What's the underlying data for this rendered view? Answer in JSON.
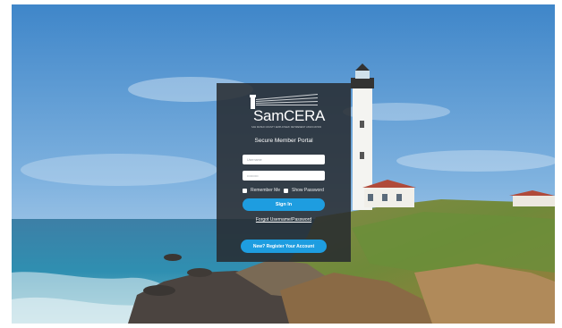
{
  "logo": {
    "name": "SamCERA",
    "subtitle": "SAN MATEO COUNTY EMPLOYEES' RETIREMENT ASSOCIATION"
  },
  "portal": {
    "title": "Secure Member Portal"
  },
  "form": {
    "username_placeholder": "Username",
    "password_placeholder": "Password",
    "password_value": "••••••••••",
    "remember_label": "Remember Me",
    "show_password_label": "Show Password",
    "signin_label": "Sign In",
    "forgot_label": "Forgot Username/Password",
    "register_label": "New? Register Your Account"
  },
  "colors": {
    "accent": "#1e9de0",
    "panel": "#262a2e"
  }
}
